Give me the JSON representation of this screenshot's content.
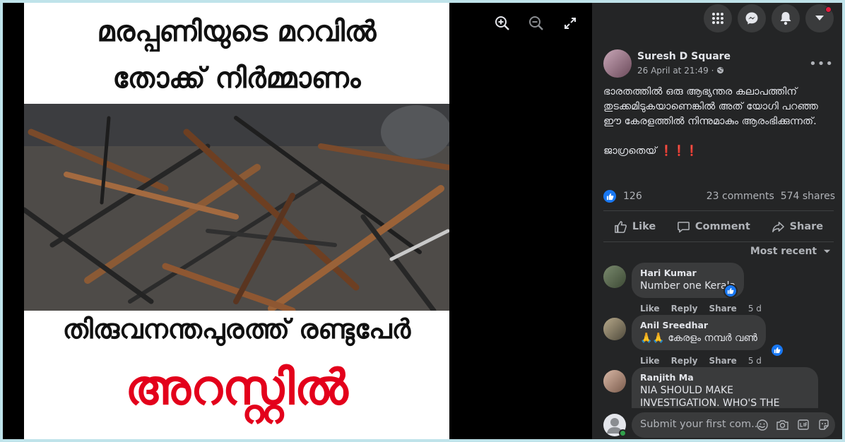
{
  "viewer": {
    "poster": {
      "line1": "മരപ്പണിയുടെ മറവിൽ",
      "line2": "തോക്ക് നിർമ്മാണം",
      "line3": "തിരുവനന്തപുരത്ത് രണ്ടുപേർ",
      "line4": "അറസ്റ്റിൽ",
      "headline_color": "#e3001b"
    },
    "tools": [
      "zoom-in-icon",
      "zoom-out-icon",
      "fullscreen-icon"
    ]
  },
  "topbar": {
    "icons": [
      "menu-grid-icon",
      "messenger-icon",
      "notifications-bell-icon",
      "account-caret-icon"
    ]
  },
  "post": {
    "author": "Suresh D Square",
    "timestamp": "26 April at 21:49 ·",
    "privacy_icon": "globe-icon",
    "text_para1": "ഭാരതത്തിൽ ഒരു ആഭ്യന്തര കലാപത്തിന് തുടക്കമിടുകയാണെങ്കിൽ അത് യോഗി പറഞ്ഞ ഈ കേരളത്തിൽ നിന്നുമാകും ആരംഭിക്കുന്നത്.",
    "text_para2": "ജാഗ്രതെയ് ❗❗❗",
    "reactions": "126",
    "comments_count": "23 comments",
    "shares_count": "574 shares",
    "accent": "#1877f2"
  },
  "actions": {
    "like": "Like",
    "comment": "Comment",
    "share": "Share"
  },
  "sort_label": "Most recent",
  "comments": [
    {
      "name": "Hari Kumar",
      "text": "Number one Kerala",
      "like": "Like",
      "reply": "Reply",
      "share": "Share",
      "time": "5 d"
    },
    {
      "name": "Anil Sreedhar",
      "text": "🙏🙏 കേരളം നമ്പർ വൺ",
      "like": "Like",
      "reply": "Reply",
      "share": "Share",
      "time": "5 d"
    },
    {
      "name": "Ranjith Ma",
      "text": "NIA SHOULD MAKE INVESTIGATION. WHO'S THE"
    }
  ],
  "composer": {
    "placeholder": "Submit your first com..."
  }
}
